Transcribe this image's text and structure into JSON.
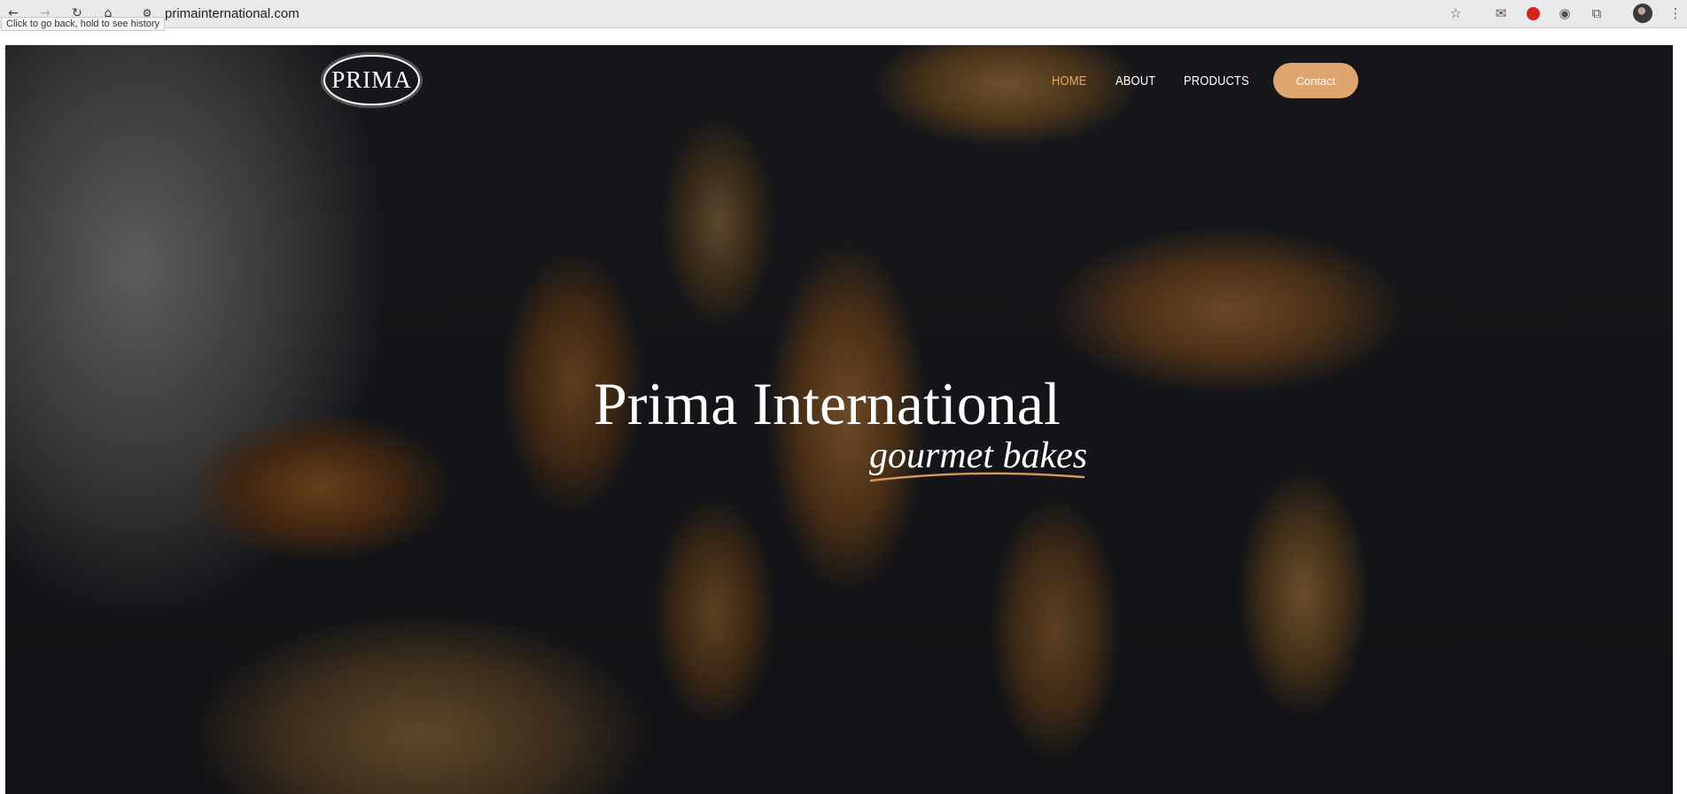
{
  "browser": {
    "url": "primainternational.com",
    "tooltip": "Click to go back, hold to see history",
    "icons": {
      "back": "arrow-left-icon",
      "forward": "arrow-right-icon",
      "reload": "reload-icon",
      "home": "home-icon",
      "site_settings": "tune-icon",
      "bookmark": "star-icon",
      "gmail": "mail-icon",
      "extension_red": "red-shield-icon",
      "camera": "camera-icon",
      "extensions": "puzzle-icon",
      "menu": "more-vert-icon"
    }
  },
  "site": {
    "logo_text": "PRIMA",
    "nav": {
      "home": "HOME",
      "about": "ABOUT",
      "products": "PRODUCTS",
      "contact": "Contact"
    },
    "hero": {
      "title": "Prima International",
      "subtitle": "gourmet bakes"
    },
    "colors": {
      "accent": "#dea66e",
      "active_nav": "#e5a869"
    }
  }
}
